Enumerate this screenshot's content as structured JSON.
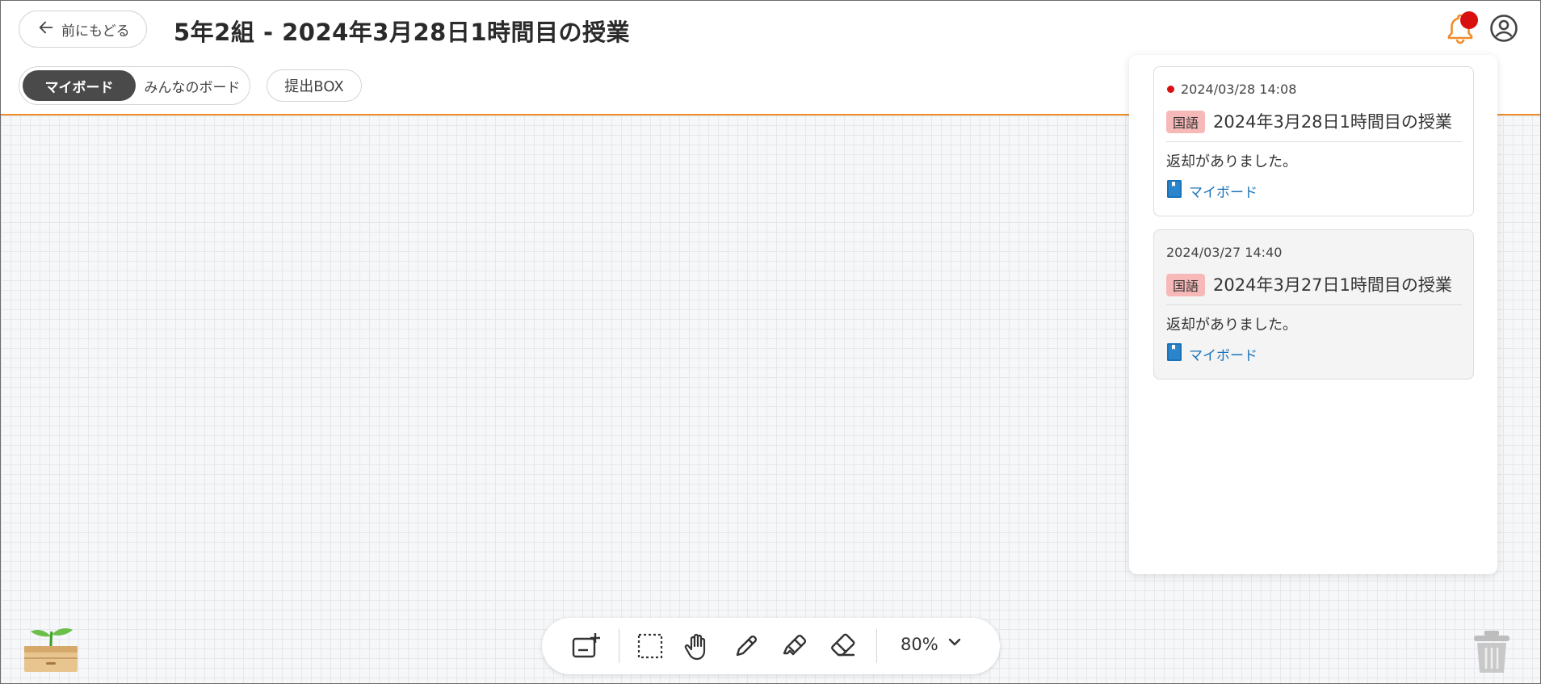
{
  "header": {
    "back_label": "前にもどる",
    "title": "5年2組 - 2024年3月28日1時間目の授業",
    "tabs": {
      "my_board": "マイボード",
      "everyone_board": "みんなのボード",
      "submit_box": "提出BOX"
    }
  },
  "notifications": [
    {
      "time": "2024/03/28 14:08",
      "unread": true,
      "subject": "国語",
      "title": "2024年3月28日1時間目の授業",
      "message": "返却がありました。",
      "link": "マイボード"
    },
    {
      "time": "2024/03/27 14:40",
      "unread": false,
      "subject": "国語",
      "title": "2024年3月27日1時間目の授業",
      "message": "返却がありました。",
      "link": "マイボード"
    }
  ],
  "toolbar": {
    "zoom_label": "80%",
    "tools": [
      "add-card-icon",
      "select-area-icon",
      "hand-icon",
      "pen-icon",
      "marker-icon",
      "eraser-icon"
    ]
  },
  "colors": {
    "accent": "#f08c2a",
    "notification_dot": "#d81010",
    "subject_badge": "#f7b8b8",
    "link": "#1a73b8",
    "active_tab": "#4a4a4a"
  }
}
